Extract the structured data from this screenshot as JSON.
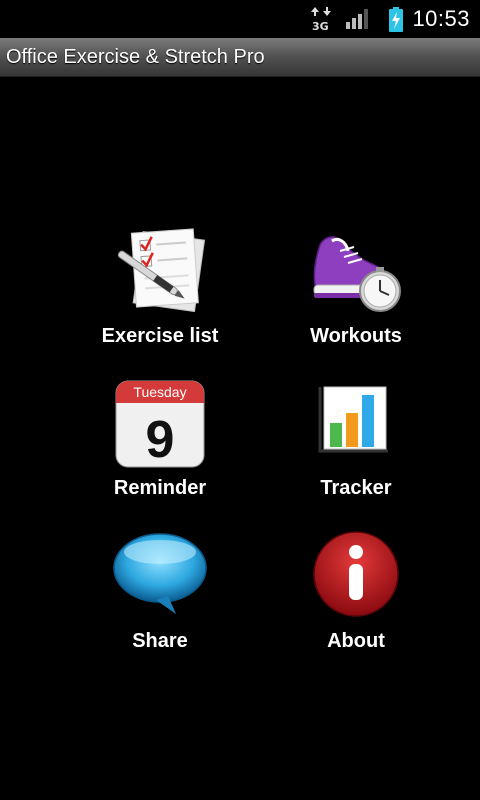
{
  "status_bar": {
    "network": "3G",
    "time": "10:53"
  },
  "app": {
    "title": "Office Exercise & Stretch Pro"
  },
  "menu": {
    "items": [
      {
        "id": "exercise-list",
        "label": "Exercise list",
        "icon": "checklist-icon"
      },
      {
        "id": "workouts",
        "label": "Workouts",
        "icon": "sneaker-clock-icon"
      },
      {
        "id": "reminder",
        "label": "Reminder",
        "icon": "calendar-icon",
        "calendar_day": "Tuesday",
        "calendar_date": "9"
      },
      {
        "id": "tracker",
        "label": "Tracker",
        "icon": "bar-chart-icon"
      },
      {
        "id": "share",
        "label": "Share",
        "icon": "speech-bubble-icon"
      },
      {
        "id": "about",
        "label": "About",
        "icon": "info-icon"
      }
    ]
  },
  "colors": {
    "background": "#000000",
    "calendar_header": "#d43a3a",
    "about_red": "#c4121a",
    "bubble_blue": "#2ea8e0",
    "sneaker_purple": "#8d3fc0"
  }
}
